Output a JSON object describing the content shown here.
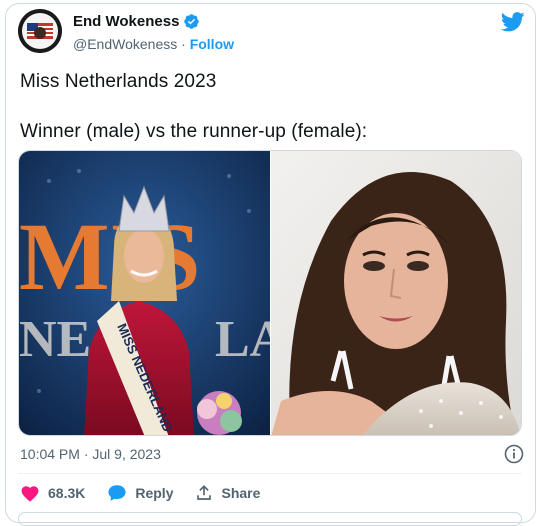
{
  "author": {
    "display_name": "End Wokeness",
    "handle": "@EndWokeness",
    "separator": "·",
    "follow_label": "Follow"
  },
  "tweet": {
    "line1": "Miss Netherlands 2023",
    "line2": "Winner (male) vs the runner-up (female):"
  },
  "media": {
    "left_banner_big": "MIS",
    "left_banner_small": "NE",
    "left_banner_small_right": "LA",
    "sash_text": "MISS NEDERLAND"
  },
  "meta": {
    "timestamp": "10:04 PM · Jul 9, 2023"
  },
  "actions": {
    "likes": "68.3K",
    "reply_label": "Reply",
    "share_label": "Share"
  },
  "colors": {
    "brand_blue": "#1d9bf0",
    "like_red": "#f91880",
    "text_gray": "#536471"
  },
  "icons": [
    "twitter-bird-icon",
    "verified-badge-icon",
    "heart-icon",
    "reply-bubble-icon",
    "share-icon",
    "info-icon"
  ]
}
